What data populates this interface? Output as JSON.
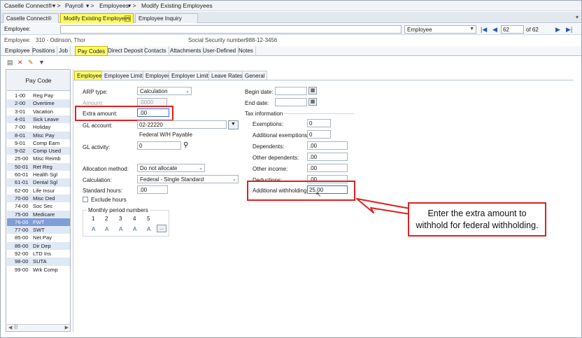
{
  "breadcrumb": {
    "app": "Caselle Connect®",
    "module": "Payroll",
    "section": "Employees",
    "page": "Modify Existing Employees"
  },
  "doc_tabs": [
    "Caselle Connect®",
    "Modify Existing Employees",
    "Employee Inquiry"
  ],
  "employee_bar": {
    "label": "Employee:",
    "value": "",
    "sort_select": "Employee",
    "record_number": "62",
    "record_total": "of 62"
  },
  "info": {
    "employee_label": "Employee:",
    "employee_value": "310 - Odinson, Thor",
    "ssn_label": "Social Security number:",
    "ssn_value": "988-12-3456"
  },
  "main_tabs": [
    "Employee",
    "Positions",
    "Job",
    "Pay Codes",
    "Direct Deposit",
    "Contacts",
    "Attachments",
    "User-Defined",
    "Notes"
  ],
  "pay_code_header": "Pay Code",
  "pay_codes": [
    {
      "code": "1-00",
      "name": "Reg Pay"
    },
    {
      "code": "2-00",
      "name": "Overtime"
    },
    {
      "code": "3-01",
      "name": "Vacation"
    },
    {
      "code": "4-01",
      "name": "Sick Leave"
    },
    {
      "code": "7-00",
      "name": "Holiday"
    },
    {
      "code": "8-01",
      "name": "Misc Pay"
    },
    {
      "code": "9-01",
      "name": "Comp Earn"
    },
    {
      "code": "9-02",
      "name": "Comp Used"
    },
    {
      "code": "25-00",
      "name": "Misc Reimb"
    },
    {
      "code": "50-01",
      "name": "Ret Reg"
    },
    {
      "code": "60-01",
      "name": "Health Sgl"
    },
    {
      "code": "61-01",
      "name": "Dental Sgl"
    },
    {
      "code": "62-00",
      "name": "Life Insur"
    },
    {
      "code": "70-00",
      "name": "Misc Ded"
    },
    {
      "code": "74-00",
      "name": "Soc Sec"
    },
    {
      "code": "75-00",
      "name": "Medicare"
    },
    {
      "code": "76-00",
      "name": "FWT"
    },
    {
      "code": "77-00",
      "name": "SWT"
    },
    {
      "code": "85-00",
      "name": "Net Pay"
    },
    {
      "code": "86-00",
      "name": "Dir Dep"
    },
    {
      "code": "92-00",
      "name": "LTD Ins"
    },
    {
      "code": "98-00",
      "name": "SUTA"
    },
    {
      "code": "99-00",
      "name": "Wrk Comp"
    }
  ],
  "sub_tabs": [
    "Employee",
    "Employee Limits",
    "Employer",
    "Employer Limits",
    "Leave Rates",
    "General"
  ],
  "form": {
    "arp_type_label": "ARP type:",
    "arp_type_value": "Calculation",
    "amount_label": "Amount:",
    "amount_value": ".0000",
    "extra_amount_label": "Extra amount:",
    "extra_amount_value": ".00",
    "gl_account_label": "GL account:",
    "gl_account_value": "02-22220",
    "gl_account_desc": "Federal W/H Payable",
    "gl_activity_label": "GL activity:",
    "gl_activity_value": "0",
    "allocation_label": "Allocation method:",
    "allocation_value": "Do not allocate",
    "calculation_label": "Calculation:",
    "calculation_value": "Federal - Single Standard",
    "std_hours_label": "Standard hours:",
    "std_hours_value": ".00",
    "exclude_hours_label": "Exclude hours",
    "monthly_label": "Monthly period numbers",
    "periods": [
      "1",
      "2",
      "3",
      "4",
      "5"
    ],
    "period_values": [
      "A",
      "A",
      "A",
      "A",
      "A"
    ],
    "more_label": "..."
  },
  "right_form": {
    "begin_date_label": "Begin date:",
    "end_date_label": "End date:",
    "tax_info_label": "Tax information",
    "exemptions_label": "Exemptions:",
    "exemptions_value": "0",
    "add_exemptions_label": "Additional exemptions:",
    "add_exemptions_value": "0",
    "dependents_label": "Dependents:",
    "dependents_value": ".00",
    "other_dependents_label": "Other dependents:",
    "other_dependents_value": ".00",
    "other_income_label": "Other income:",
    "other_income_value": ".00",
    "deductions_label": "Deductions:",
    "deductions_value": ".00",
    "add_withholding_label": "Additional withholding:",
    "add_withholding_value": "25.00"
  },
  "callout": {
    "line1": "Enter the extra amount to",
    "line2": "withhold for federal withholding."
  },
  "colors": {
    "highlight": "#ffff66",
    "annotation_red": "#e02020",
    "selected_row": "#7f9dd6"
  }
}
